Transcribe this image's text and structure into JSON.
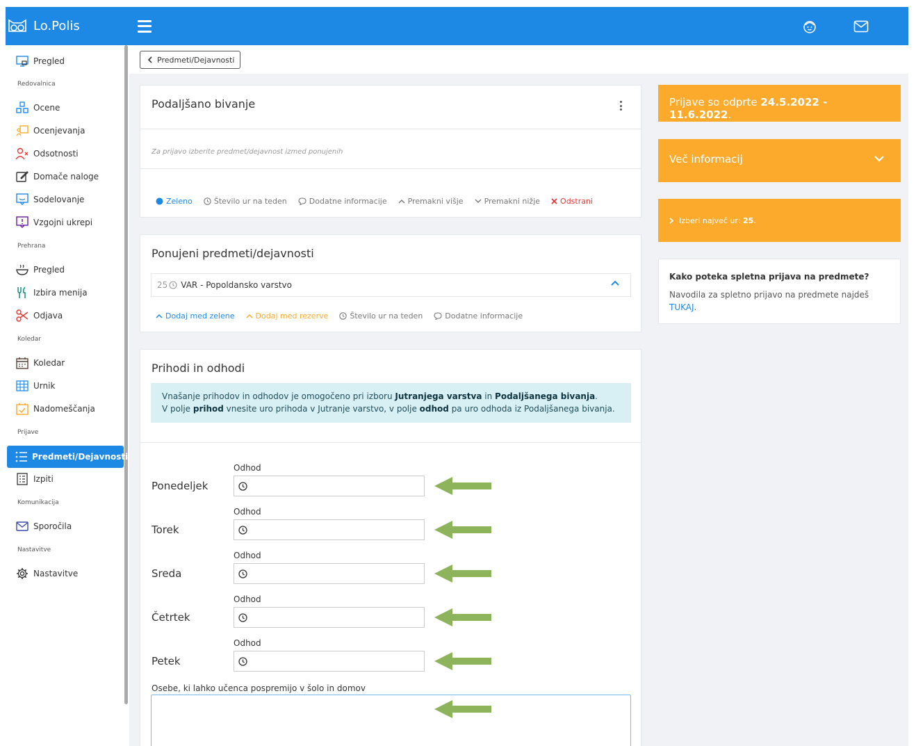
{
  "app": {
    "title": "Lo.Polis"
  },
  "colors": {
    "primary": "#1e88e5",
    "accent_orange": "#fbaa2b",
    "arrow_green": "#8db45a",
    "danger": "#e53935"
  },
  "sidebar": {
    "items": [
      {
        "label": "Pregled",
        "icon": "monitor-icon"
      },
      {
        "section": "Redovalnica"
      },
      {
        "label": "Ocene",
        "icon": "blocks-icon"
      },
      {
        "label": "Ocenjevanja",
        "icon": "presentation-icon"
      },
      {
        "label": "Odsotnosti",
        "icon": "user-x-icon"
      },
      {
        "label": "Domače naloge",
        "icon": "edit-icon"
      },
      {
        "label": "Sodelovanje",
        "icon": "chat-icon"
      },
      {
        "label": "Vzgojni ukrepi",
        "icon": "alert-message-icon"
      },
      {
        "section": "Prehrana"
      },
      {
        "label": "Pregled",
        "icon": "bowl-icon"
      },
      {
        "label": "Izbira menija",
        "icon": "cutlery-icon"
      },
      {
        "label": "Odjava",
        "icon": "scissors-icon"
      },
      {
        "section": "Koledar"
      },
      {
        "label": "Koledar",
        "icon": "calendar-icon"
      },
      {
        "label": "Urnik",
        "icon": "grid-icon"
      },
      {
        "label": "Nadomeščanja",
        "icon": "calendar-check-icon"
      },
      {
        "section": "Prijave"
      },
      {
        "label": "Predmeti/Dejavnosti",
        "icon": "list-icon",
        "active": true
      },
      {
        "label": "Izpiti",
        "icon": "checklist-icon"
      },
      {
        "section": "Komunikacija"
      },
      {
        "label": "Sporočila",
        "icon": "mail-icon"
      },
      {
        "section": "Nastavitve"
      },
      {
        "label": "Nastavitve",
        "icon": "gear-icon"
      }
    ]
  },
  "breadcrumb": {
    "back_label": "Predmeti/Dejavnosti"
  },
  "selected_card": {
    "title": "Podaljšano bivanje",
    "hint": "Za prijavo izberite predmet/dejavnost izmed ponujenih",
    "actions": {
      "green": "Zeleno",
      "hours": "Število ur na teden",
      "info": "Dodatne informacije",
      "up": "Premakni višje",
      "down": "Premakni nižje",
      "remove": "Odstrani"
    }
  },
  "offered_card": {
    "title": "Ponujeni predmeti/dejavnosti",
    "subject": {
      "hours": "25",
      "name": "VAR - Popoldansko varstvo"
    },
    "actions": {
      "add_green": "Dodaj med zelene",
      "add_reserve": "Dodaj med rezerve",
      "hours": "Število ur na teden",
      "info": "Dodatne informacije"
    }
  },
  "arrivals_card": {
    "title": "Prihodi in odhodi",
    "info": {
      "l1_a": "Vnašanje prihodov in odhodov je omogočeno pri izboru ",
      "l1_b": "Jutranjega varstva",
      "l1_c": " in ",
      "l1_d": "Podaljšanega bivanja",
      "l1_e": ".",
      "l2_a": "V polje ",
      "l2_b": "prihod",
      "l2_c": " vnesite uro prihoda v Jutranje varstvo, v polje ",
      "l2_d": "odhod",
      "l2_e": " pa uro odhoda iz Podaljšanega bivanja."
    },
    "field_label": "Odhod",
    "days": [
      "Ponedeljek",
      "Torek",
      "Sreda",
      "Četrtek",
      "Petek"
    ],
    "escort_label": "Osebe, ki lahko učenca pospremijo v šolo in domov"
  },
  "right": {
    "open": {
      "prefix": "Prijave so odprte ",
      "dates": "24.5.2022 - 11.6.2022",
      "suffix": "."
    },
    "more_info": "Več informacij",
    "max_hours": {
      "prefix": "Izberi največ ur: ",
      "value": "25",
      "suffix": "."
    },
    "help": {
      "title": "Kako poteka spletna prijava na predmete?",
      "text": "Navodila za spletno prijavo na predmete najdeš ",
      "link": "TUKAJ",
      "suffix": "."
    }
  }
}
